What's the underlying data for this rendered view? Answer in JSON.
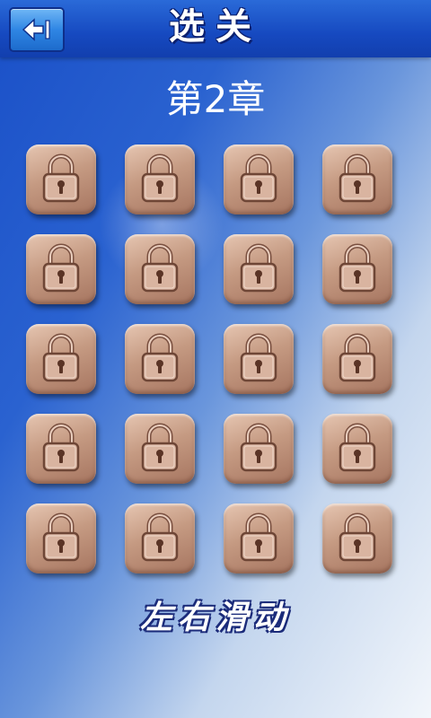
{
  "header": {
    "title": "选关",
    "back_icon": "back-arrow-icon"
  },
  "chapter_label": "第2章",
  "levels": [
    {
      "state": "locked",
      "icon": "lock-icon"
    },
    {
      "state": "locked",
      "icon": "lock-icon"
    },
    {
      "state": "locked",
      "icon": "lock-icon"
    },
    {
      "state": "locked",
      "icon": "lock-icon"
    },
    {
      "state": "locked",
      "icon": "lock-icon"
    },
    {
      "state": "locked",
      "icon": "lock-icon"
    },
    {
      "state": "locked",
      "icon": "lock-icon"
    },
    {
      "state": "locked",
      "icon": "lock-icon"
    },
    {
      "state": "locked",
      "icon": "lock-icon"
    },
    {
      "state": "locked",
      "icon": "lock-icon"
    },
    {
      "state": "locked",
      "icon": "lock-icon"
    },
    {
      "state": "locked",
      "icon": "lock-icon"
    },
    {
      "state": "locked",
      "icon": "lock-icon"
    },
    {
      "state": "locked",
      "icon": "lock-icon"
    },
    {
      "state": "locked",
      "icon": "lock-icon"
    },
    {
      "state": "locked",
      "icon": "lock-icon"
    },
    {
      "state": "locked",
      "icon": "lock-icon"
    },
    {
      "state": "locked",
      "icon": "lock-icon"
    },
    {
      "state": "locked",
      "icon": "lock-icon"
    },
    {
      "state": "locked",
      "icon": "lock-icon"
    }
  ],
  "footer_hint": "左右滑动",
  "colors": {
    "background_blue": "#1a50c8",
    "level_tile": "#c59a82",
    "lock_stroke": "#6e4636"
  }
}
